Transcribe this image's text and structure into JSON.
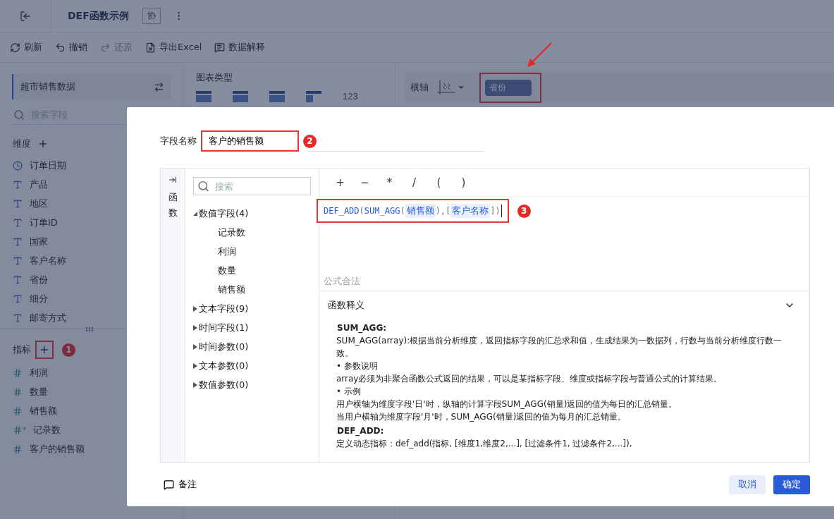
{
  "header": {
    "title": "DEF函数示例",
    "badge": "协"
  },
  "toolbar": [
    {
      "label": "刷新",
      "kind": "refresh",
      "disabled": false
    },
    {
      "label": "撤销",
      "kind": "undo",
      "disabled": false
    },
    {
      "label": "还原",
      "kind": "redo",
      "disabled": true
    },
    {
      "label": "导出Excel",
      "kind": "excel",
      "disabled": false
    },
    {
      "label": "数据解释",
      "kind": "explain",
      "disabled": false
    }
  ],
  "dataset": {
    "name": "超市销售数据"
  },
  "field_search": {
    "placeholder": "搜索字段"
  },
  "dimensions": {
    "title": "维度",
    "fields": [
      {
        "name": "订单日期",
        "kind": "date"
      },
      {
        "name": "产品",
        "kind": "text"
      },
      {
        "name": "地区",
        "kind": "text"
      },
      {
        "name": "订单ID",
        "kind": "text"
      },
      {
        "name": "国家",
        "kind": "text"
      },
      {
        "name": "客户名称",
        "kind": "text"
      },
      {
        "name": "省份",
        "kind": "text"
      },
      {
        "name": "细分",
        "kind": "text"
      },
      {
        "name": "邮寄方式",
        "kind": "text"
      }
    ]
  },
  "measures": {
    "title": "指标",
    "marker": "1",
    "fields": [
      {
        "name": "利润",
        "kind": "number"
      },
      {
        "name": "数量",
        "kind": "number"
      },
      {
        "name": "销售额",
        "kind": "number"
      },
      {
        "name": "记录数",
        "kind": "count"
      },
      {
        "name": "客户的销售额",
        "kind": "calc"
      }
    ]
  },
  "chart_types": {
    "title": "图表类型",
    "items": [
      {
        "kind": "table"
      },
      {
        "kind": "crosstab"
      },
      {
        "kind": "list"
      },
      {
        "kind": "block"
      },
      {
        "kind": "number",
        "label": "123"
      }
    ]
  },
  "axis": {
    "label": "横轴",
    "chip": "省份"
  },
  "dialog": {
    "field_name": {
      "label": "字段名称",
      "value": "客户的销售额",
      "marker": "2"
    },
    "side_tab": "函数",
    "search": {
      "placeholder": "搜索"
    },
    "tree": [
      {
        "label": "数值字段(4)",
        "expanded": true,
        "children": [
          {
            "label": "记录数"
          },
          {
            "label": "利润"
          },
          {
            "label": "数量"
          },
          {
            "label": "销售额"
          }
        ]
      },
      {
        "label": "文本字段(9)",
        "expanded": false
      },
      {
        "label": "时间字段(1)",
        "expanded": false
      },
      {
        "label": "时间参数(0)",
        "expanded": false
      },
      {
        "label": "文本参数(0)",
        "expanded": false
      },
      {
        "label": "数值参数(0)",
        "expanded": false
      }
    ],
    "operators": [
      "+",
      "−",
      "*",
      "/",
      "(",
      ")"
    ],
    "formula": {
      "marker": "3",
      "tokens": [
        {
          "text": "DEF_ADD",
          "kind": "func"
        },
        {
          "text": "(",
          "kind": "punct"
        },
        {
          "text": "SUM_AGG",
          "kind": "func"
        },
        {
          "text": "(",
          "kind": "punct"
        },
        {
          "text": "销售额",
          "kind": "field"
        },
        {
          "text": ")",
          "kind": "punct"
        },
        {
          "text": ",",
          "kind": "punct"
        },
        {
          "text": "[",
          "kind": "punct"
        },
        {
          "text": "客户名称",
          "kind": "field"
        },
        {
          "text": "]",
          "kind": "punct"
        },
        {
          "text": ")",
          "kind": "punct"
        }
      ]
    },
    "status": "公式合法",
    "explanation": {
      "title": "函数释义",
      "expanded": true,
      "blocks": [
        {
          "heading": "SUM_AGG:",
          "lines": [
            "SUM_AGG(array):根据当前分析维度，返回指标字段的汇总求和值，生成结果为一数据列，行数与当前分析维度行数一致。",
            "• 参数说明",
            "array必须为非聚合函数公式返回的结果，可以是某指标字段、维度或指标字段与普通公式的计算结果。",
            "• 示例",
            "用户横轴为维度字段'日'时，纵轴的计算字段SUM_AGG(销量)返回的值为每日的汇总销量。",
            "当用户横轴为维度字段'月'时，SUM_AGG(销量)返回的值为每月的汇总销量。"
          ]
        },
        {
          "heading": "DEF_ADD:",
          "lines": [
            "定义动态指标：def_add(指标, [维度1,维度2,...], [过滤条件1, 过滤条件2,...]),"
          ]
        }
      ]
    },
    "note": "备注",
    "buttons": [
      {
        "label": "取消",
        "kind": "secondary"
      },
      {
        "label": "确定",
        "kind": "primary"
      }
    ]
  }
}
